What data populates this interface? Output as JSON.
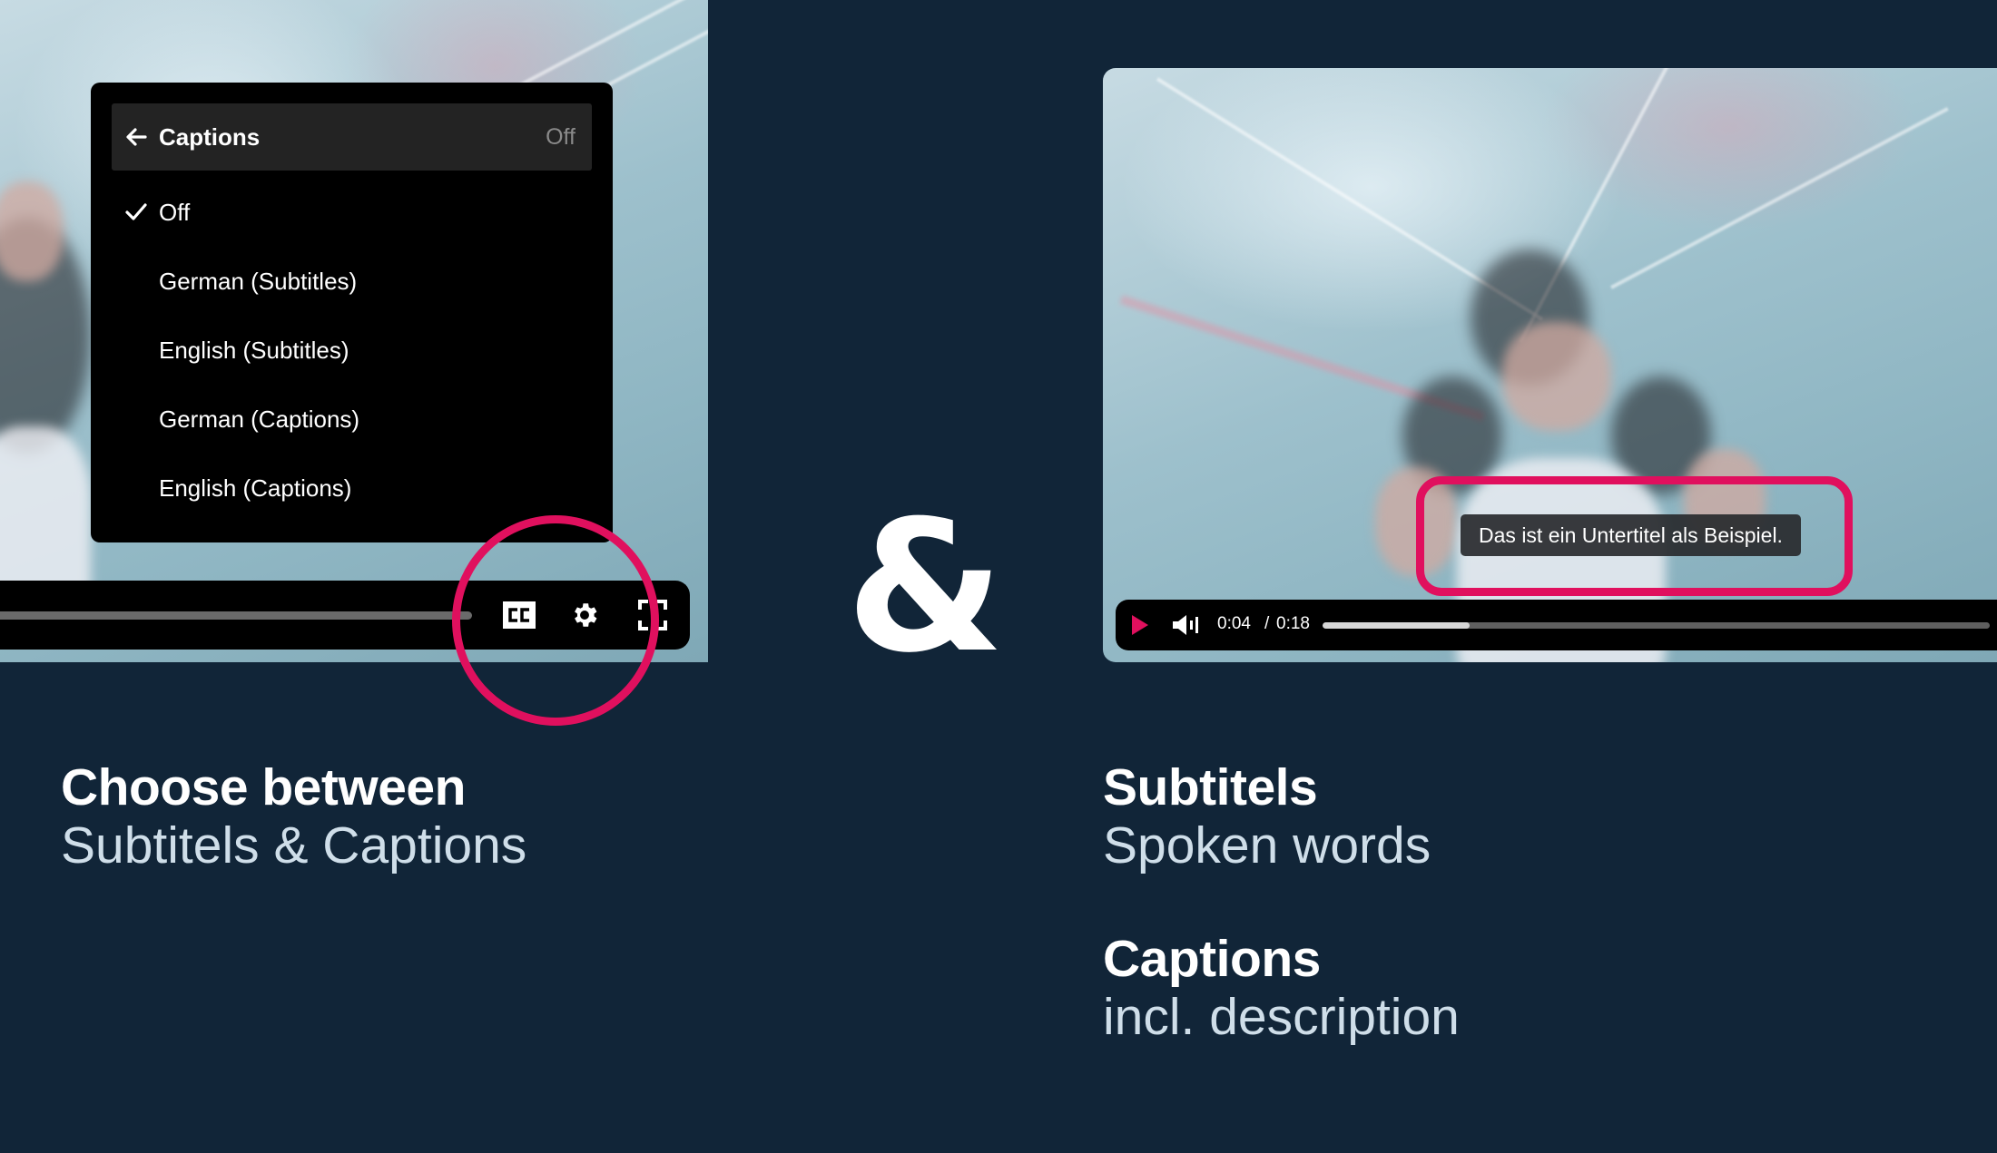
{
  "colors": {
    "background": "#112538",
    "accent": "#e0105e",
    "heading": "#ffffff",
    "subheading": "#cfdee9"
  },
  "left_player": {
    "captions_menu": {
      "back_icon": "arrow-left-icon",
      "title": "Captions",
      "current_value": "Off",
      "items": [
        {
          "label": "Off",
          "selected": true,
          "icon": "check-icon"
        },
        {
          "label": "German (Subtitles)",
          "selected": false
        },
        {
          "label": "English (Subtitles)",
          "selected": false
        },
        {
          "label": "German (Captions)",
          "selected": false
        },
        {
          "label": "English (Captions)",
          "selected": false
        }
      ]
    },
    "controls": {
      "icons": [
        "closed-captions-icon",
        "gear-icon",
        "fullscreen-icon"
      ]
    }
  },
  "separator": "&",
  "right_player": {
    "subtitle_text": "Das ist ein Untertitel als Beispiel.",
    "controls": {
      "play_icon": "play-icon",
      "volume_icon": "volume-icon",
      "time_current": "0:04",
      "time_separator": "/",
      "time_total": "0:18",
      "progress_percent": 22
    }
  },
  "left_text": {
    "heading": "Choose between",
    "subheading": "Subtitels & Captions"
  },
  "right_text": {
    "blocks": [
      {
        "heading": "Subtitels",
        "subheading": "Spoken words"
      },
      {
        "heading": "Captions",
        "subheading": "incl. description"
      }
    ]
  }
}
